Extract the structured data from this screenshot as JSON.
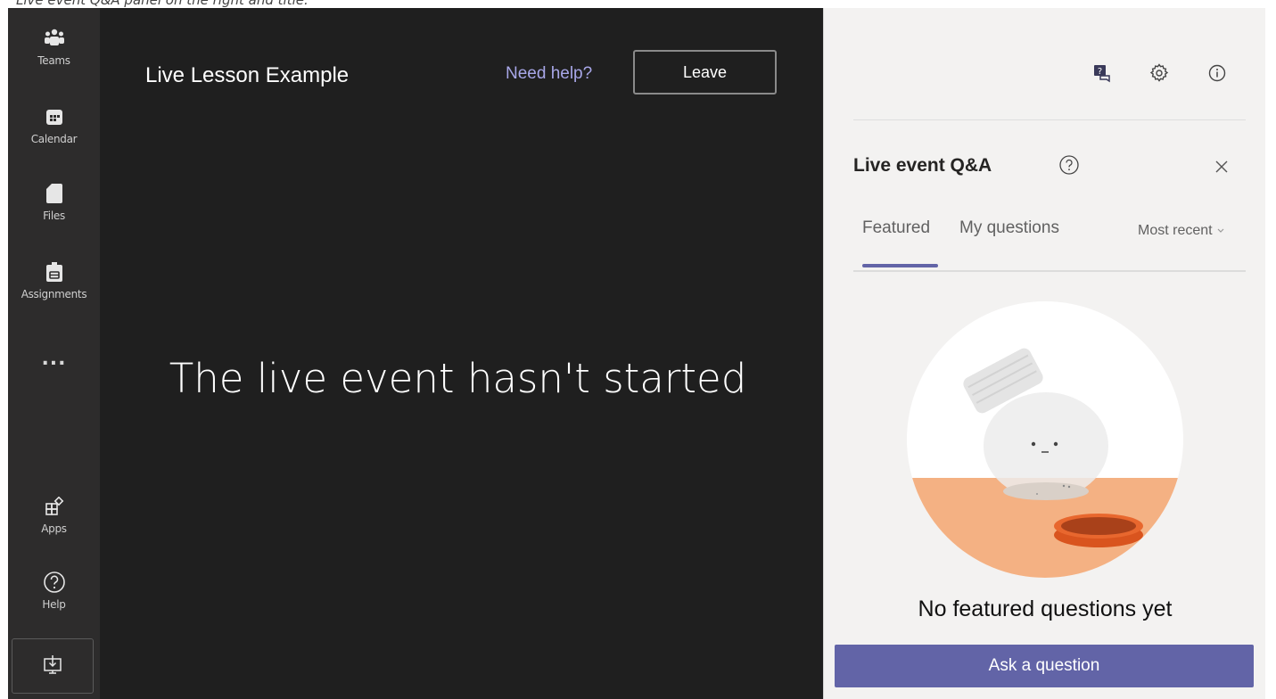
{
  "caption": "Live event Q&A panel on the right and title.",
  "rail": {
    "items": [
      {
        "label": "Teams",
        "icon": "teams-icon"
      },
      {
        "label": "Calendar",
        "icon": "calendar-icon"
      },
      {
        "label": "Files",
        "icon": "files-icon"
      },
      {
        "label": "Assignments",
        "icon": "assignments-icon"
      },
      {
        "label": "Apps",
        "icon": "apps-icon"
      },
      {
        "label": "Help",
        "icon": "help-icon"
      }
    ],
    "more_label": "...",
    "download_icon": "download-icon"
  },
  "stage": {
    "title": "Live Lesson Example",
    "help_link": "Need help?",
    "leave_label": "Leave",
    "message": "The live event hasn't started"
  },
  "panel": {
    "top_icons": [
      "qa-icon",
      "gear-icon",
      "info-icon"
    ],
    "title": "Live event Q&A",
    "tabs": [
      {
        "label": "Featured",
        "selected": true
      },
      {
        "label": "My questions",
        "selected": false
      }
    ],
    "sort_label": "Most recent",
    "empty_text": "No featured questions yet",
    "ask_label": "Ask a question"
  },
  "colors": {
    "rail_bg": "#2d2c2c",
    "stage_bg": "#1f1f1f",
    "accent": "#6264a7",
    "link": "#a8a7e8",
    "panel_bg": "#f3f2f1",
    "illustration_orange": "#f4b183"
  }
}
